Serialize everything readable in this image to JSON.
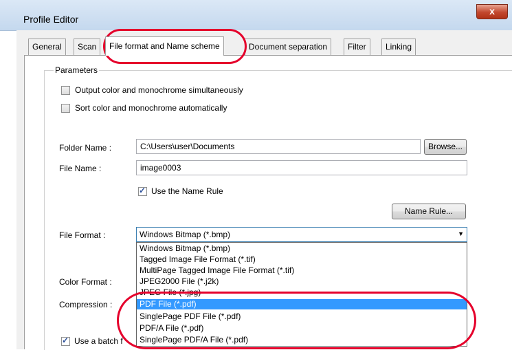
{
  "window": {
    "title": "Profile Editor",
    "close_label": "x"
  },
  "tabs": [
    {
      "label": "General"
    },
    {
      "label": "Scan"
    },
    {
      "label": "File format and Name scheme"
    },
    {
      "label": "Document separation"
    },
    {
      "label": "Filter"
    },
    {
      "label": "Linking"
    }
  ],
  "parameters": {
    "legend": "Parameters",
    "output_simultaneous": "Output color and monochrome simultaneously",
    "sort_automatic": "Sort color and monochrome automatically"
  },
  "folder": {
    "label": "Folder Name :",
    "value": "C:\\Users\\user\\Documents",
    "browse_label": "Browse..."
  },
  "file_name": {
    "label": "File Name :",
    "value": "image0003"
  },
  "name_rule": {
    "use_label": "Use the Name Rule",
    "button_label": "Name Rule..."
  },
  "file_format": {
    "label": "File Format :",
    "selected": "Windows Bitmap (*.bmp)",
    "options": [
      "Windows Bitmap (*.bmp)",
      "Tagged Image File Format (*.tif)",
      "MultiPage Tagged Image File Format (*.tif)",
      "JPEG2000 File (*.j2k)",
      "JPEG File (*.jpg)",
      "PDF File (*.pdf)",
      "SinglePage PDF File (*.pdf)",
      "PDF/A File (*.pdf)",
      "SinglePage PDF/A File (*.pdf)"
    ],
    "highlighted_option": "PDF File (*.pdf)"
  },
  "color_format": {
    "label": "Color Format :"
  },
  "compression": {
    "label": "Compression :"
  },
  "batch": {
    "label": "Use a batch f"
  },
  "colors": {
    "accent": "#3399ff",
    "annotation": "#e5002b"
  }
}
